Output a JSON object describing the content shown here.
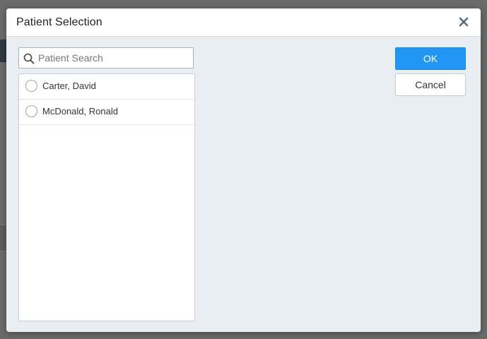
{
  "dialog": {
    "title": "Patient Selection",
    "close_icon": "close-icon"
  },
  "search": {
    "placeholder": "Patient Search",
    "value": "",
    "icon": "search-icon"
  },
  "patients": [
    {
      "name": "Carter, David",
      "selected": false
    },
    {
      "name": "McDonald, Ronald",
      "selected": false
    }
  ],
  "buttons": {
    "ok_label": "OK",
    "cancel_label": "Cancel"
  },
  "colors": {
    "primary": "#2196f3",
    "dialog_bg": "#e9eef3",
    "overlay": "#6b6b6b"
  }
}
